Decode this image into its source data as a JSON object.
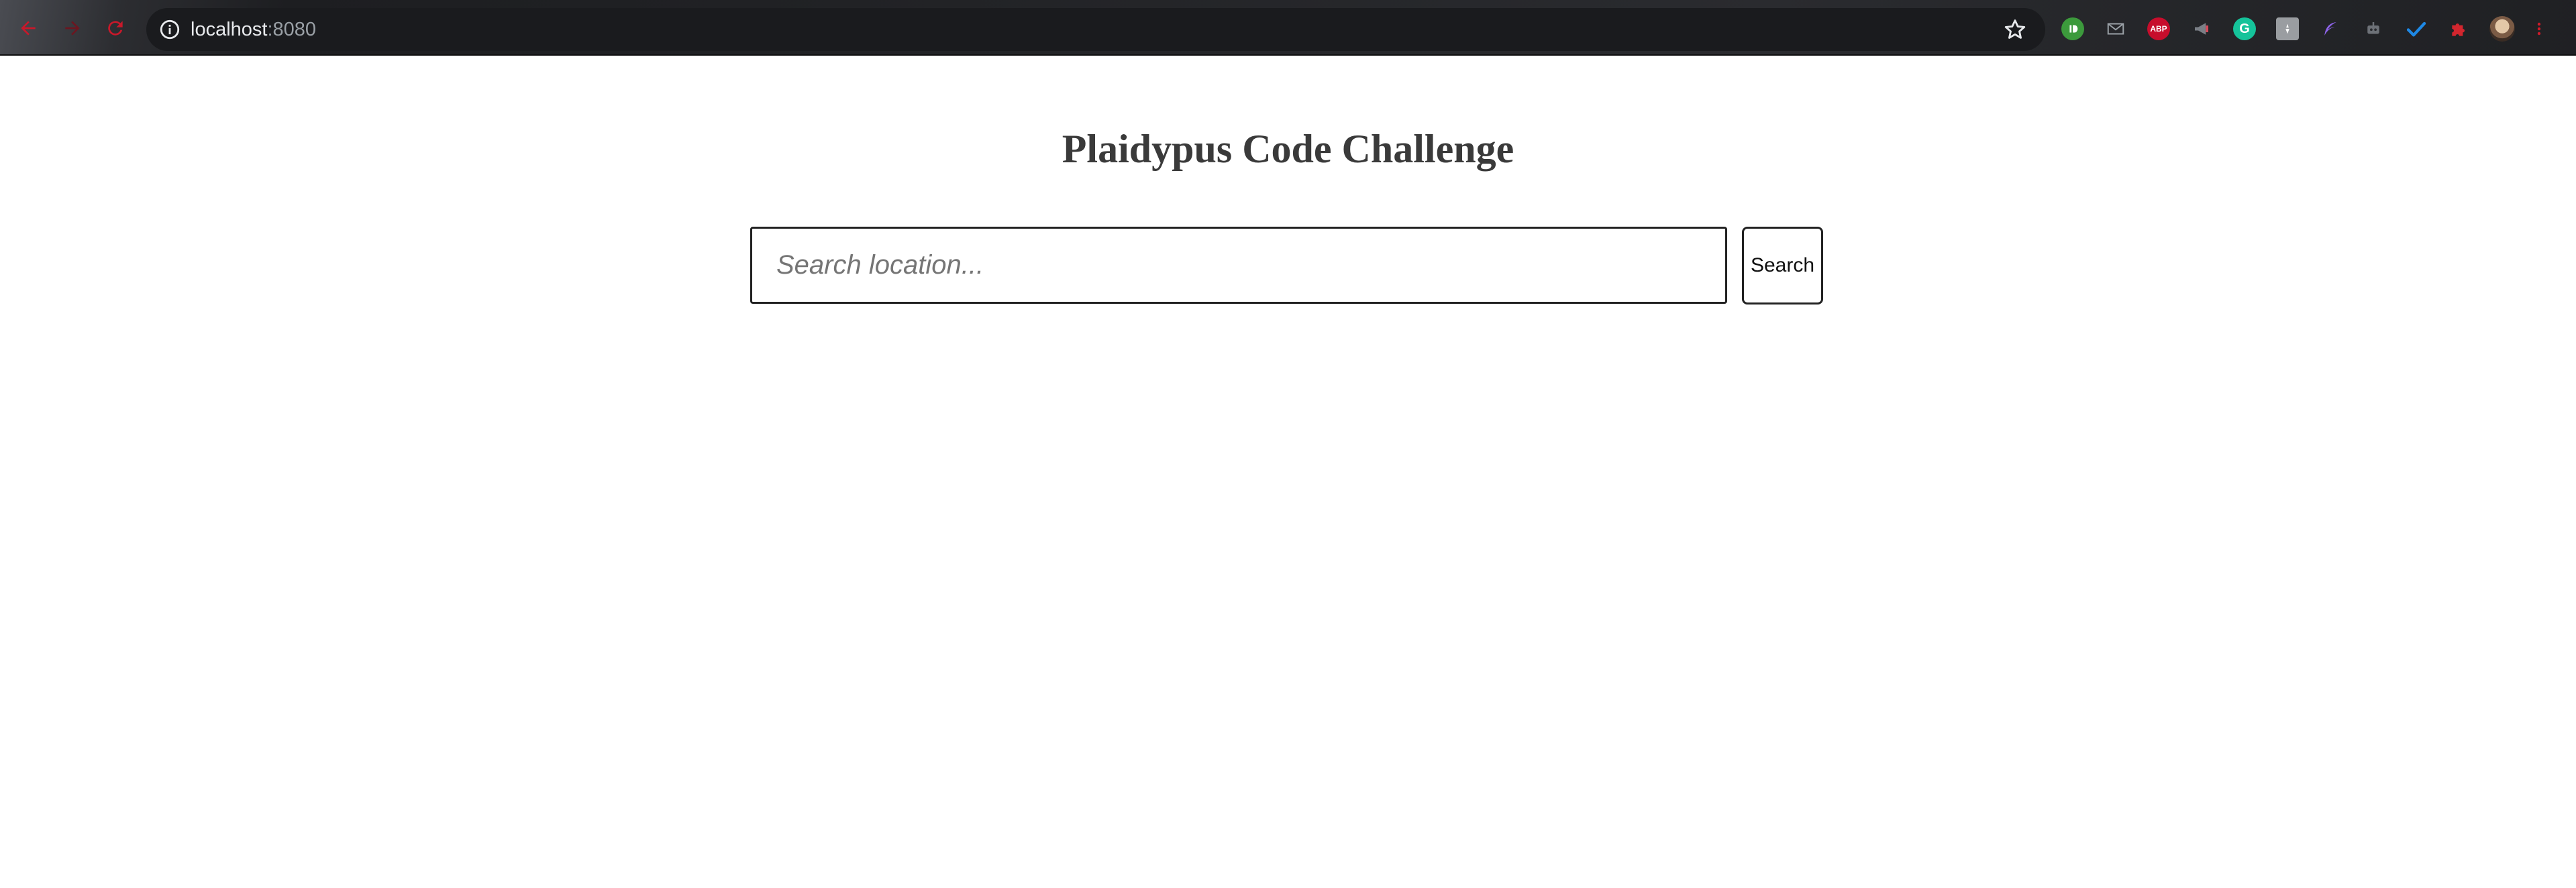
{
  "browser": {
    "url_host": "localhost",
    "url_port": ":8080",
    "extensions": [
      {
        "name": "reddit-enhancement-icon",
        "text": "",
        "color": "#3c9a3c"
      },
      {
        "name": "mail-icon",
        "text": "",
        "color": "#5f6368"
      },
      {
        "name": "adblock-plus-icon",
        "text": "ABP",
        "color": "#c70d2c"
      },
      {
        "name": "megaphone-icon",
        "text": "",
        "color": "#6a6d72"
      },
      {
        "name": "grammarly-icon",
        "text": "G",
        "color": "#15c39a"
      },
      {
        "name": "tile-extension-icon",
        "text": "",
        "color": "#8a8d91"
      },
      {
        "name": "feather-icon",
        "text": "",
        "color": "#8d63e8"
      },
      {
        "name": "robot-icon",
        "text": "",
        "color": "#5f6368"
      },
      {
        "name": "checkmark-icon",
        "text": "",
        "color": "#1e88e5"
      },
      {
        "name": "puzzle-icon",
        "text": "",
        "color": "#d3262e"
      }
    ],
    "accent_color": "#d01a2a"
  },
  "page": {
    "title": "Plaidypus Code Challenge",
    "search_placeholder": "Search location...",
    "search_value": "",
    "search_button_label": "Search"
  }
}
